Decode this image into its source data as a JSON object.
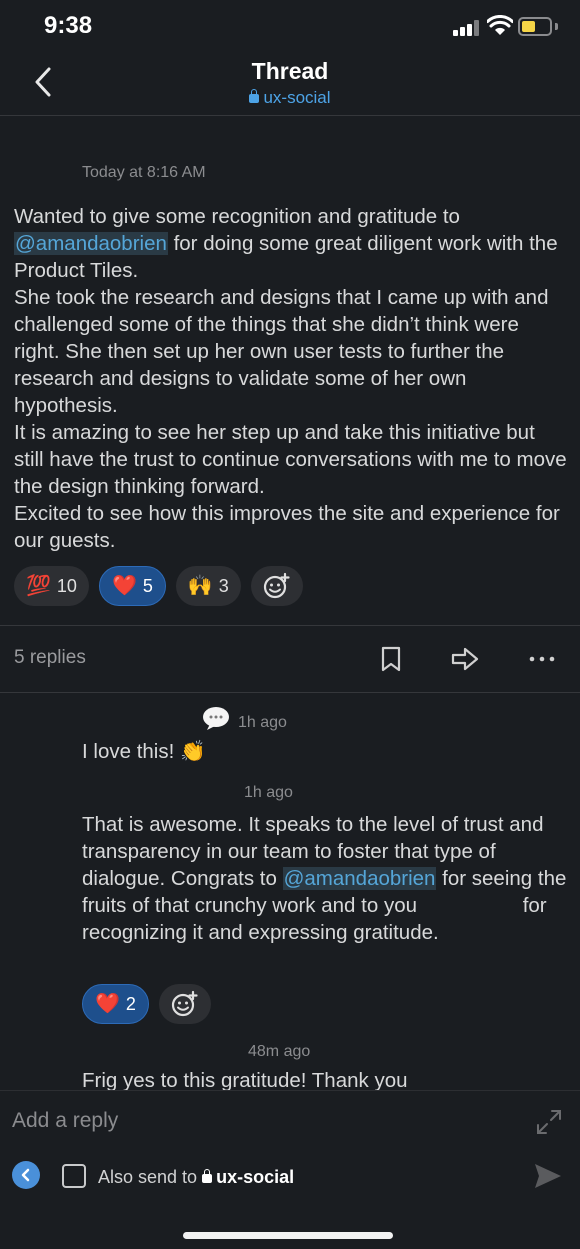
{
  "status_bar": {
    "time": "9:38"
  },
  "header": {
    "title": "Thread",
    "channel": "ux-social"
  },
  "main_message": {
    "timestamp": "Today at 8:16 AM",
    "paragraphs": [
      {
        "pre": "Wanted to give some recognition and gratitude to ",
        "mention": "@amandaobrien",
        "post": " for doing some great diligent work with the Product Tiles."
      },
      {
        "text": "She took the research and designs that I came up with and challenged some of the things that she didn’t think were right. She then set up her own user tests to further the research and designs to validate some of her own hypothesis."
      },
      {
        "text": "It is amazing to see her step up and take this initiative but still have the trust to continue conversations with me to move the design thinking forward."
      },
      {
        "text": "Excited to see how this improves the site and experience for our guests."
      }
    ],
    "reactions": [
      {
        "emoji": "💯",
        "count": "10",
        "active": false
      },
      {
        "emoji": "❤️",
        "count": "5",
        "active": true
      },
      {
        "emoji": "🙌",
        "count": "3",
        "active": false
      }
    ]
  },
  "thread_bar": {
    "replies_label": "5 replies"
  },
  "replies": [
    {
      "time": "1h ago",
      "text": "I love this! 👏"
    },
    {
      "time": "1h ago",
      "pre": "That is awesome. It speaks to the level of trust and transparency in our team to foster that type of dialogue. Congrats to ",
      "mention": "@amandaobrien",
      "mid": " for seeing the fruits of that crunchy work and to you",
      "gap": "                    ",
      "post": "for recognizing it and expressing gratitude.",
      "reactions": [
        {
          "emoji": "❤️",
          "count": "2",
          "active": true
        }
      ]
    },
    {
      "time": "48m ago",
      "text": "Frig yes to this gratitude! Thank you"
    }
  ],
  "composer": {
    "placeholder": "Add a reply",
    "also_send_prefix": "Also send to",
    "also_send_channel": "ux-social"
  },
  "colors": {
    "background": "#1a1d21",
    "link": "#4da3e6",
    "mention_text": "#55a6d8",
    "reaction_active": "#1e4f8c"
  }
}
